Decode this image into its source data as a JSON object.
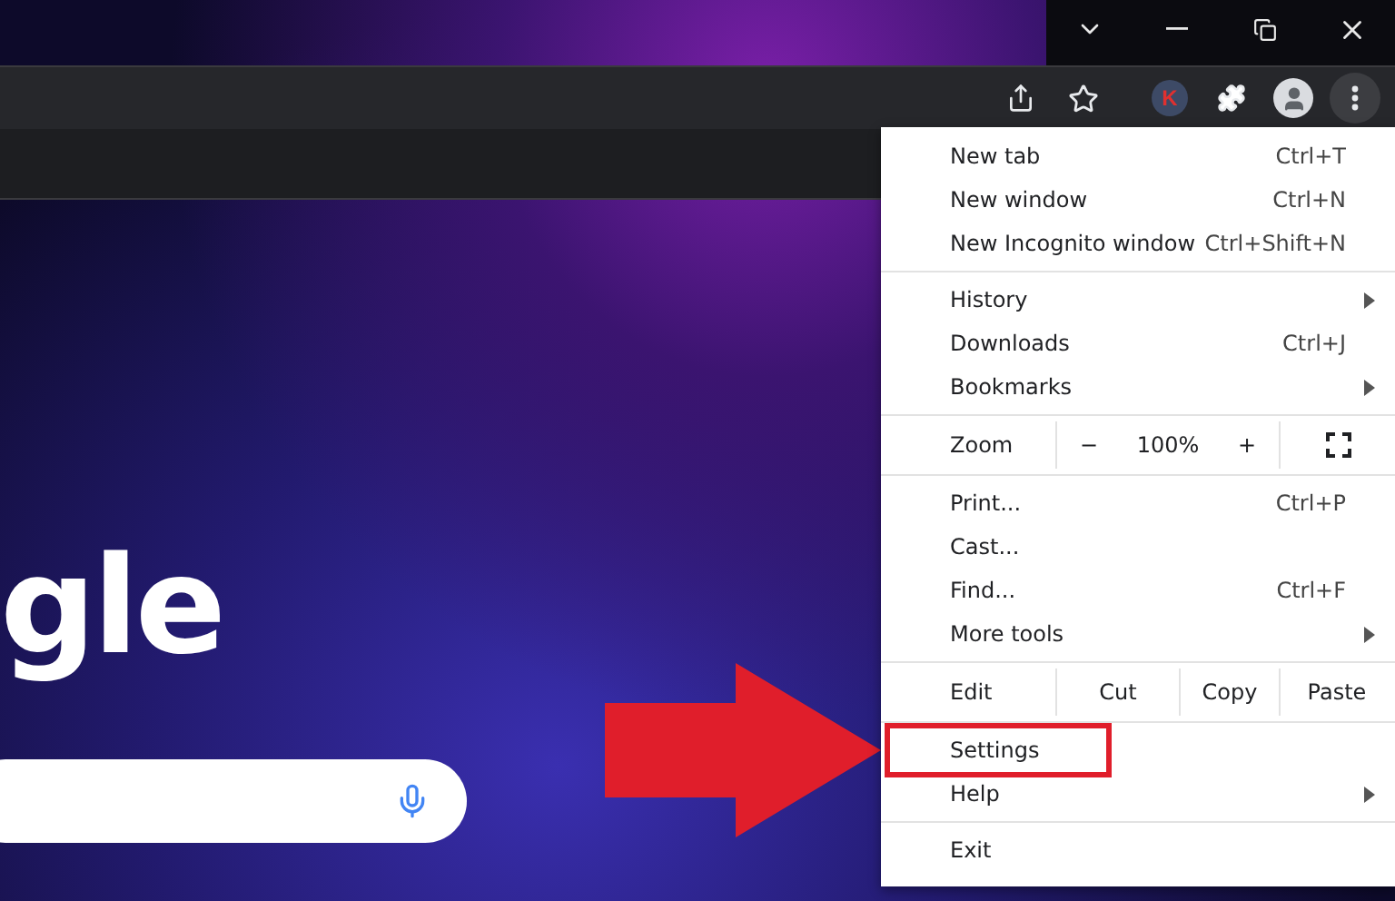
{
  "logo_text": "gle",
  "toolbar": {
    "profile_badge": "K"
  },
  "menu": {
    "groups": [
      {
        "kind": "items",
        "items": [
          {
            "label": "New tab",
            "shortcut": "Ctrl+T",
            "submenu": false,
            "highlighted": false
          },
          {
            "label": "New window",
            "shortcut": "Ctrl+N",
            "submenu": false,
            "highlighted": false
          },
          {
            "label": "New Incognito window",
            "shortcut": "Ctrl+Shift+N",
            "submenu": false,
            "highlighted": false
          }
        ]
      },
      {
        "kind": "items",
        "items": [
          {
            "label": "History",
            "submenu": true,
            "highlighted": false
          },
          {
            "label": "Downloads",
            "shortcut": "Ctrl+J",
            "submenu": false,
            "highlighted": false
          },
          {
            "label": "Bookmarks",
            "submenu": true,
            "highlighted": false
          }
        ]
      },
      {
        "kind": "zoom",
        "label": "Zoom",
        "minus": "−",
        "value": "100%",
        "plus": "+"
      },
      {
        "kind": "items",
        "items": [
          {
            "label": "Print...",
            "shortcut": "Ctrl+P",
            "submenu": false,
            "highlighted": false
          },
          {
            "label": "Cast...",
            "submenu": false,
            "highlighted": false
          },
          {
            "label": "Find...",
            "shortcut": "Ctrl+F",
            "submenu": false,
            "highlighted": false
          },
          {
            "label": "More tools",
            "submenu": true,
            "highlighted": false
          }
        ]
      },
      {
        "kind": "edit",
        "label": "Edit",
        "actions": [
          "Cut",
          "Copy",
          "Paste"
        ]
      },
      {
        "kind": "items",
        "items": [
          {
            "label": "Settings",
            "submenu": false,
            "highlighted": true
          },
          {
            "label": "Help",
            "submenu": true,
            "highlighted": false
          }
        ]
      },
      {
        "kind": "items",
        "items": [
          {
            "label": "Exit",
            "submenu": false,
            "highlighted": false
          }
        ]
      }
    ]
  }
}
